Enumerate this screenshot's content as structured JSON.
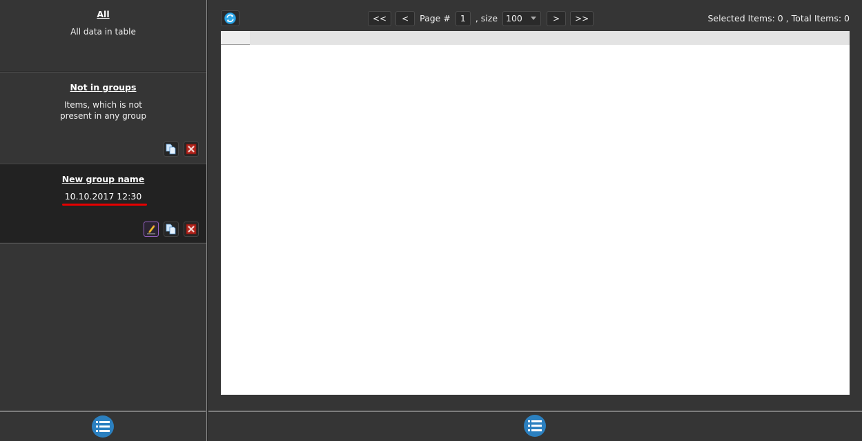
{
  "sidebar": {
    "groups": [
      {
        "title": "All",
        "description": "All data in table"
      },
      {
        "title": "Not in groups",
        "description_line1": "Items, which is not",
        "description_line2": "present in any group"
      },
      {
        "title": "New group name",
        "date": "10.10.2017 12:30"
      }
    ],
    "actions": {
      "edit": "edit-icon",
      "copy": "copy-icon",
      "delete": "delete-icon"
    },
    "list_button_icon": "list-icon"
  },
  "toolbar": {
    "refresh_icon": "refresh-icon",
    "first_label": "<<",
    "prev_label": "<",
    "page_label": "Page #",
    "page_value": "1",
    "size_label": ", size",
    "size_value": "100",
    "next_label": ">",
    "last_label": ">>"
  },
  "status": {
    "selected_label": "Selected Items:",
    "selected_value": "0",
    "separator": ",",
    "total_label": "Total Items:",
    "total_value": "0"
  },
  "colors": {
    "background": "#353535",
    "selected_group_bg": "#222222",
    "accent_blue": "#2b80c0",
    "delete_red": "#c0392b",
    "edit_border": "#9a63c9",
    "date_underline": "#e60000"
  }
}
